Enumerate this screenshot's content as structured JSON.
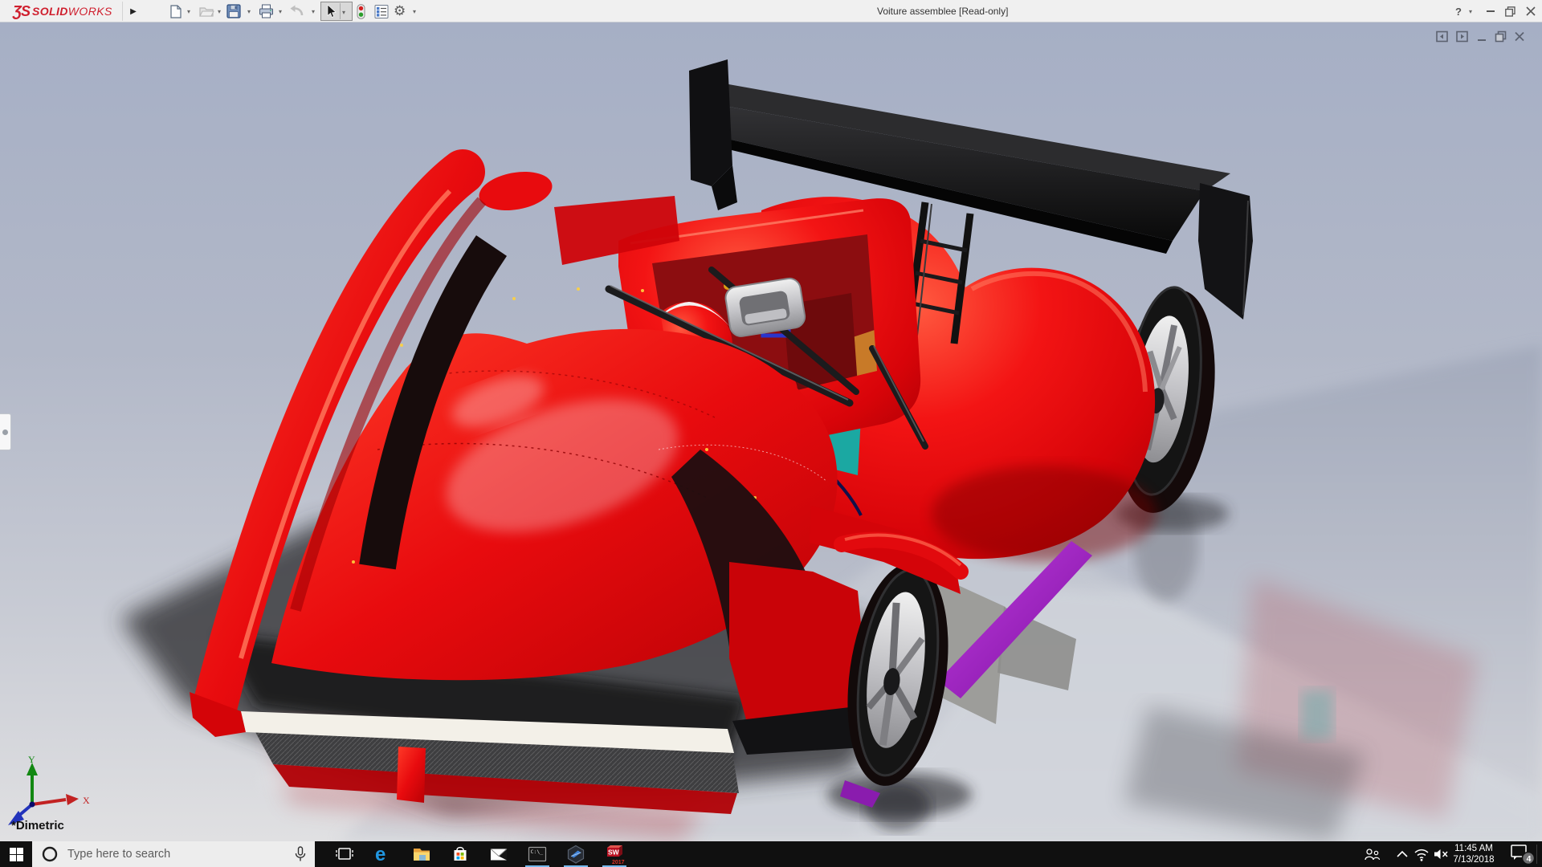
{
  "titlebar": {
    "logo": {
      "glyph": "ƷS",
      "solid": "SOLID",
      "works": "WORKS"
    },
    "flyout_arrow": "▶",
    "title": "Voiture assemblee [Read-only]",
    "help_label": "?",
    "tools": [
      "new-document",
      "open",
      "save",
      "print",
      "undo",
      "select",
      "rebuild",
      "display-list",
      "options"
    ]
  },
  "viewport": {
    "view_orientation_label": "*Dimetric",
    "triad": {
      "x_label": "X",
      "y_label": "Y"
    },
    "doc_window_controls": [
      "pane-left",
      "pane-right",
      "minimize",
      "restore",
      "close"
    ],
    "model_description": "Red LMP-style race car assembly: black rear wing on struts, cockpit with driver in red-white helmet, yellow harness, silver intake, silver five-spoke wheels, purple skirt trim, white front splitter over mesh radiator"
  },
  "colors": {
    "car_red": "#e30613",
    "wing_black": "#161616",
    "rim_silver": "#d8d8d8",
    "belt_yellow": "#ffe11a",
    "trim_purple": "#9a27b8",
    "accent_teal": "#1fb3ab",
    "background_top": "#a6afc5",
    "background_bottom": "#dfdfe1",
    "taskbar": "#101010",
    "running_underline": "#76b9ed"
  },
  "taskbar": {
    "search_placeholder": "Type here to search",
    "edge_glyph": "e",
    "cmd_text": "C:\\_",
    "sw_label": "SW",
    "sw_year": "2017",
    "apps": [
      "task-view",
      "edge",
      "file-explorer",
      "store",
      "mail",
      "command-prompt",
      "hexagon-app",
      "solidworks-2017"
    ],
    "running_apps": [
      "command-prompt",
      "hexagon-app",
      "solidworks-2017"
    ],
    "tray": {
      "time": "11:45 AM",
      "date": "7/13/2018",
      "notification_count": "4"
    }
  }
}
